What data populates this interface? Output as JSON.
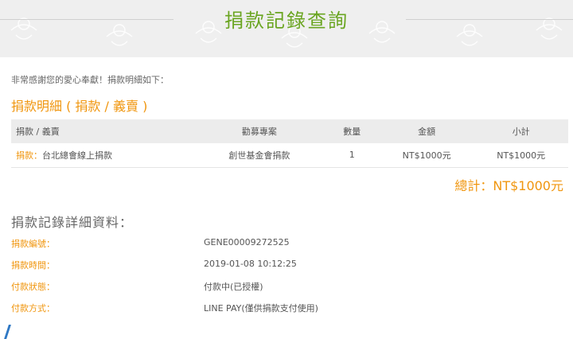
{
  "banner": {
    "title": "捐款記錄查詢"
  },
  "thanks_text": "非常感謝您的愛心奉獻！捐款明細如下：",
  "section_title": "捐款明細 ( 捐款 / 義賣 )",
  "table": {
    "headers": [
      "捐款 / 義賣",
      "勸募專案",
      "數量",
      "金額",
      "小計"
    ],
    "rows": [
      {
        "type_label": "捐款：",
        "name": "台北總會線上捐款",
        "project": "創世基金會捐款",
        "qty": "1",
        "amount": "NT$1000元",
        "subtotal": "NT$1000元"
      }
    ]
  },
  "total": "總計：NT$1000元",
  "details": {
    "title": "捐款記錄詳細資料：",
    "rows": [
      {
        "label": "捐款編號：",
        "value": "GENE00009272525"
      },
      {
        "label": "捐款時間：",
        "value": "2019-01-08 10:12:25"
      },
      {
        "label": "付款狀態：",
        "value": "付款中(已授權)"
      },
      {
        "label": "付款方式：",
        "value": "LINE PAY(僅供捐款支付使用)"
      }
    ]
  },
  "colors": {
    "accent": "#f0960f",
    "title_green": "#6aa521",
    "banner_bg": "#efefef"
  }
}
